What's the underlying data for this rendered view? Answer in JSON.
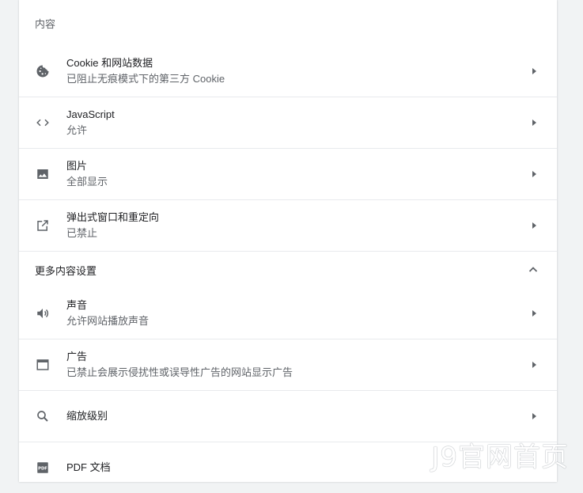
{
  "section": {
    "title": "内容"
  },
  "rows": [
    {
      "title": "Cookie 和网站数据",
      "subtitle": "已阻止无痕模式下的第三方 Cookie"
    },
    {
      "title": "JavaScript",
      "subtitle": "允许"
    },
    {
      "title": "图片",
      "subtitle": "全部显示"
    },
    {
      "title": "弹出式窗口和重定向",
      "subtitle": "已禁止"
    }
  ],
  "more": {
    "title": "更多内容设置"
  },
  "more_rows": [
    {
      "title": "声音",
      "subtitle": "允许网站播放声音"
    },
    {
      "title": "广告",
      "subtitle": "已禁止会展示侵扰性或误导性广告的网站显示广告"
    },
    {
      "title": "缩放级别"
    },
    {
      "title": "PDF 文档"
    }
  ],
  "watermark": "J9官网首页",
  "colors": {
    "accent": "#5f6368",
    "background": "#f1f3f4",
    "divider": "#e8eaed"
  }
}
